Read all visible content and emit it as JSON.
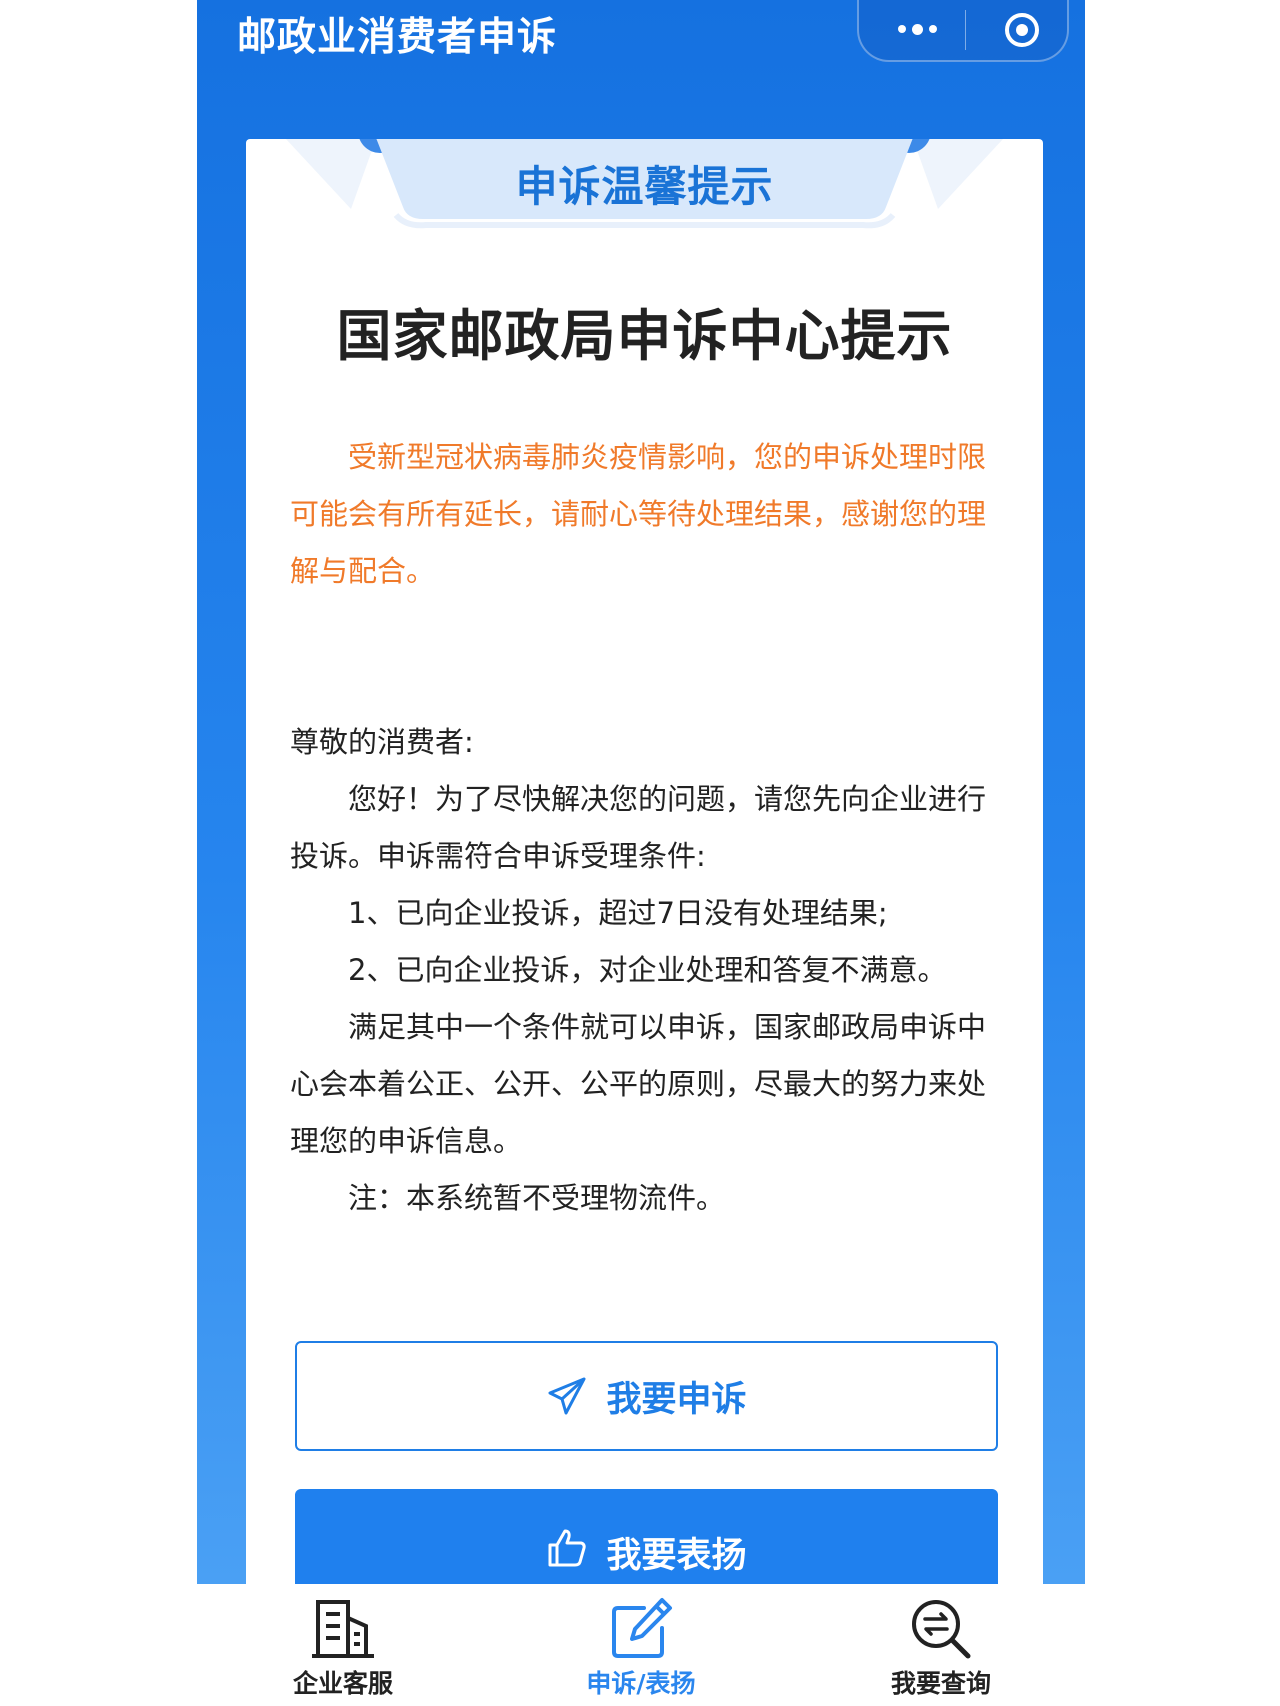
{
  "header": {
    "title": "邮政业消费者申诉"
  },
  "tab_header": {
    "title": "申诉温馨提示"
  },
  "main": {
    "heading": "国家邮政局申诉中心提示",
    "notice": "受新型冠状病毒肺炎疫情影响，您的申诉处理时限可能会有所有延长，请耐心等待处理结果，感谢您的理解与配合。",
    "greeting": "尊敬的消费者:",
    "intro": "您好！为了尽快解决您的问题，请您先向企业进行投诉。申诉需符合申诉受理条件:",
    "condition_1": "1、已向企业投诉，超过7日没有处理结果;",
    "condition_2": "2、已向企业投诉，对企业处理和答复不满意。",
    "statement": "满足其中一个条件就可以申诉，国家邮政局申诉中心会本着公正、公开、公平的原则，尽最大的努力来处理您的申诉信息。",
    "note": "注：本系统暂不受理物流件。"
  },
  "buttons": {
    "complain_label": "我要申诉",
    "praise_label": "我要表扬"
  },
  "tabbar": {
    "items": [
      {
        "label": "企业客服",
        "icon": "building-icon",
        "active": false
      },
      {
        "label": "申诉/表扬",
        "icon": "edit-icon",
        "active": true
      },
      {
        "label": "我要查询",
        "icon": "search-icon",
        "active": false
      }
    ]
  },
  "colors": {
    "primary_blue": "#1f80ee",
    "notice_orange": "#f07a2a",
    "tab_title_blue": "#1a73d6"
  }
}
